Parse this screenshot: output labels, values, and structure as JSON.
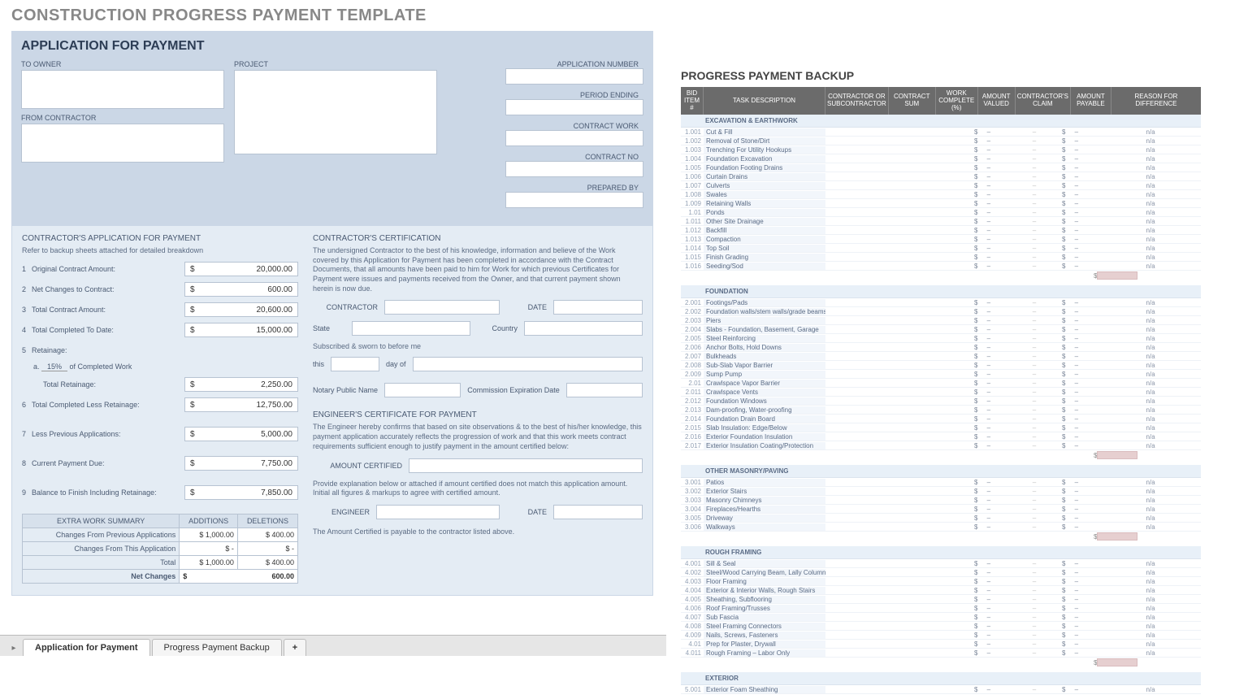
{
  "page_title": "CONSTRUCTION PROGRESS PAYMENT TEMPLATE",
  "tabs": {
    "tab1": "Application for Payment",
    "tab2": "Progress Payment Backup",
    "add": "+"
  },
  "left": {
    "title": "APPLICATION FOR PAYMENT",
    "labels": {
      "to_owner": "TO OWNER",
      "from_contractor": "FROM CONTRACTOR",
      "project": "PROJECT",
      "app_no": "APPLICATION NUMBER",
      "period": "PERIOD ENDING",
      "contract_work": "CONTRACT WORK",
      "contract_no": "CONTRACT NO",
      "prepared_by": "PREPARED BY"
    },
    "sec_a": "CONTRACTOR'S APPLICATION FOR PAYMENT",
    "note_a": "Refer to backup sheets attached for detailed breakdown",
    "lines": [
      {
        "n": "1",
        "t": "Original Contract Amount:",
        "v": "20,000.00"
      },
      {
        "n": "2",
        "t": "Net Changes to Contract:",
        "v": "600.00"
      },
      {
        "n": "3",
        "t": "Total Contract Amount:",
        "v": "20,600.00"
      },
      {
        "n": "4",
        "t": "Total Completed To Date:",
        "v": "15,000.00"
      },
      {
        "n": "5",
        "t": "Retainage:",
        "v": ""
      }
    ],
    "retain": {
      "a": "a.",
      "pct": "15%",
      "txt": "of Completed Work"
    },
    "lines2": [
      {
        "t": "Total Retainage:",
        "v": "2,250.00"
      },
      {
        "n": "6",
        "t": "Total Completed Less Retainage:",
        "v": "12,750.00"
      },
      {
        "n": "7",
        "t": "Less Previous Applications:",
        "v": "5,000.00"
      },
      {
        "n": "8",
        "t": "Current Payment Due:",
        "v": "7,750.00"
      },
      {
        "n": "9",
        "t": "Balance to Finish Including Retainage:",
        "v": "7,850.00"
      }
    ],
    "extra": {
      "title": "EXTRA WORK SUMMARY",
      "col1": "ADDITIONS",
      "col2": "DELETIONS",
      "rows": [
        {
          "l": "Changes From Previous Applications",
          "a": "$   1,000.00",
          "d": "$   400.00"
        },
        {
          "l": "Changes From This Application",
          "a": "$       -",
          "d": "$       -"
        },
        {
          "l": "Total",
          "a": "$   1,000.00",
          "d": "$   400.00"
        }
      ],
      "net": {
        "l": "Net Changes",
        "v": "600.00"
      }
    },
    "cert": {
      "h": "CONTRACTOR'S CERTIFICATION",
      "p": "The undersigned Contractor to the best of his knowledge, information and believe of the Work covered by this Application for Payment has been completed in accordance with the Contract Documents, that all amounts have been paid to him for Work for which previous Certificates for Payment were issues and payments received from the Owner, and that current payment shown herein is now due.",
      "contractor": "CONTRACTOR",
      "date": "DATE",
      "state": "State",
      "country": "Country",
      "sub": "Subscribed & sworn to before me",
      "this": "this",
      "dayof": "day of",
      "notary": "Notary Public Name",
      "comm": "Commission Expiration Date"
    },
    "eng": {
      "h": "ENGINEER'S CERTIFICATE FOR PAYMENT",
      "p": "The Engineer hereby confirms that based on site observations & to the best of his/her knowledge, this payment application accurately reflects the progression of work and that this work meets contract requirements sufficient enough to justify payment in the amount certified below:",
      "amt": "AMOUNT CERTIFIED",
      "p2": "Provide explanation below or attached if amount certified does not match this application amount. Initial all figures & markups to agree with certified amount.",
      "engineer": "ENGINEER",
      "date": "DATE",
      "p3": "The Amount Certified is payable to the contractor listed above."
    }
  },
  "right": {
    "title": "PROGRESS PAYMENT BACKUP",
    "headers": {
      "id": "BID ITEM #",
      "desc": "TASK DESCRIPTION",
      "ct": "CONTRACTOR OR SUBCONTRACTOR",
      "sum": "CONTRACT SUM",
      "wc": "WORK COMPLETE (%)",
      "av": "AMOUNT VALUED",
      "cc": "CONTRACTOR'S CLAIM",
      "ap": "AMOUNT PAYABLE",
      "r": "REASON FOR DIFFERENCE"
    },
    "cell": {
      "dollar": "$",
      "dash": "–",
      "na": "n/a"
    },
    "groups": [
      {
        "name": "EXCAVATION & EARTHWORK",
        "rows": [
          {
            "id": "1.001",
            "d": "Cut & Fill"
          },
          {
            "id": "1.002",
            "d": "Removal of Stone/Dirt"
          },
          {
            "id": "1.003",
            "d": "Trenching For Utility Hookups"
          },
          {
            "id": "1.004",
            "d": "Foundation Excavation"
          },
          {
            "id": "1.005",
            "d": "Foundation Footing Drains"
          },
          {
            "id": "1.006",
            "d": "Curtain Drains"
          },
          {
            "id": "1.007",
            "d": "Culverts"
          },
          {
            "id": "1.008",
            "d": "Swales"
          },
          {
            "id": "1.009",
            "d": "Retaining Walls"
          },
          {
            "id": "1.01",
            "d": "Ponds"
          },
          {
            "id": "1.011",
            "d": "Other Site Drainage"
          },
          {
            "id": "1.012",
            "d": "Backfill"
          },
          {
            "id": "1.013",
            "d": "Compaction"
          },
          {
            "id": "1.014",
            "d": "Top Soil"
          },
          {
            "id": "1.015",
            "d": "Finish Grading"
          },
          {
            "id": "1.016",
            "d": "Seeding/Sod"
          }
        ]
      },
      {
        "name": "FOUNDATION",
        "rows": [
          {
            "id": "2.001",
            "d": "Footings/Pads"
          },
          {
            "id": "2.002",
            "d": "Foundation walls/stem walls/grade beams"
          },
          {
            "id": "2.003",
            "d": "Piers"
          },
          {
            "id": "2.004",
            "d": "Slabs - Foundation, Basement, Garage"
          },
          {
            "id": "2.005",
            "d": "Steel Reinforcing"
          },
          {
            "id": "2.006",
            "d": "Anchor Bolts, Hold Downs"
          },
          {
            "id": "2.007",
            "d": "Bulkheads"
          },
          {
            "id": "2.008",
            "d": "Sub-Slab Vapor Barrier"
          },
          {
            "id": "2.009",
            "d": "Sump Pump"
          },
          {
            "id": "2.01",
            "d": "Crawlspace Vapor Barrier"
          },
          {
            "id": "2.011",
            "d": "Crawlspace Vents"
          },
          {
            "id": "2.012",
            "d": "Foundation Windows"
          },
          {
            "id": "2.013",
            "d": "Dam-proofing, Water-proofing"
          },
          {
            "id": "2.014",
            "d": "Foundation Drain Board"
          },
          {
            "id": "2.015",
            "d": "Slab Insulation: Edge/Below"
          },
          {
            "id": "2.016",
            "d": "Exterior Foundation Insulation"
          },
          {
            "id": "2.017",
            "d": "Exterior Insulation Coating/Protection"
          }
        ]
      },
      {
        "name": "OTHER MASONRY/PAVING",
        "rows": [
          {
            "id": "3.001",
            "d": "Patios"
          },
          {
            "id": "3.002",
            "d": "Exterior Stairs"
          },
          {
            "id": "3.003",
            "d": "Masonry Chimneys"
          },
          {
            "id": "3.004",
            "d": "Fireplaces/Hearths"
          },
          {
            "id": "3.005",
            "d": "Driveway"
          },
          {
            "id": "3.006",
            "d": "Walkways"
          }
        ]
      },
      {
        "name": "ROUGH FRAMING",
        "rows": [
          {
            "id": "4.001",
            "d": "Sill & Seal"
          },
          {
            "id": "4.002",
            "d": "Steel/Wood Carrying Beam, Lally Columns"
          },
          {
            "id": "4.003",
            "d": "Floor Framing"
          },
          {
            "id": "4.004",
            "d": "Exterior & Interior Walls, Rough Stairs"
          },
          {
            "id": "4.005",
            "d": "Sheathing, Subflooring"
          },
          {
            "id": "4.006",
            "d": "Roof Framing/Trusses"
          },
          {
            "id": "4.007",
            "d": "Sub Fascia"
          },
          {
            "id": "4.008",
            "d": "Steel Framing Connectors"
          },
          {
            "id": "4.009",
            "d": "Nails, Screws, Fasteners"
          },
          {
            "id": "4.01",
            "d": "Prep for Plaster, Drywall"
          },
          {
            "id": "4.011",
            "d": "Rough Framing – Labor Only"
          }
        ]
      },
      {
        "name": "EXTERIOR",
        "rows": [
          {
            "id": "5.001",
            "d": "Exterior Foam Sheathing"
          }
        ]
      }
    ]
  }
}
